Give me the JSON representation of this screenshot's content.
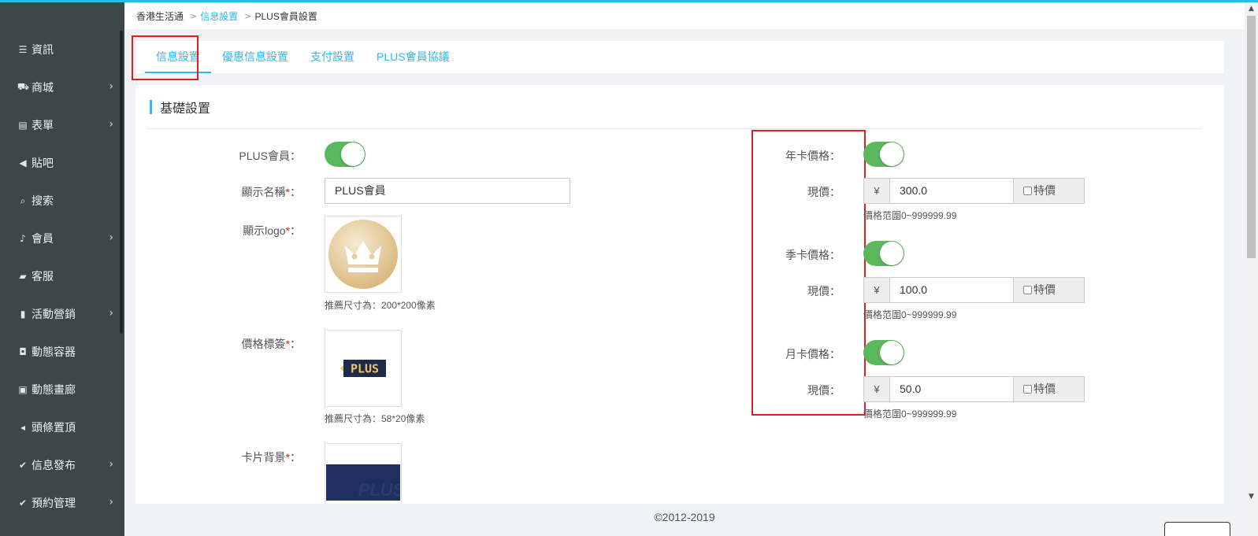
{
  "sidebar": {
    "items": [
      {
        "label": "資訊",
        "icon": "list-icon",
        "glyph": "☰",
        "chevron": false
      },
      {
        "label": "商城",
        "icon": "cart-icon",
        "glyph": "⛟",
        "chevron": true
      },
      {
        "label": "表單",
        "icon": "form-icon",
        "glyph": "▤",
        "chevron": true
      },
      {
        "label": "貼吧",
        "icon": "megaphone-icon",
        "glyph": "◀",
        "chevron": false
      },
      {
        "label": "搜索",
        "icon": "search-icon",
        "glyph": "⌕",
        "chevron": false
      },
      {
        "label": "會員",
        "icon": "bell-icon",
        "glyph": "♪",
        "chevron": true
      },
      {
        "label": "客服",
        "icon": "chat-icon",
        "glyph": "▰",
        "chevron": false
      },
      {
        "label": "活動營銷",
        "icon": "bookmark-icon",
        "glyph": "▮",
        "chevron": true
      },
      {
        "label": "動態容器",
        "icon": "drive-icon",
        "glyph": "◘",
        "chevron": false
      },
      {
        "label": "動態畫廊",
        "icon": "picture-icon",
        "glyph": "▣",
        "chevron": false
      },
      {
        "label": "頭條置頂",
        "icon": "volume-icon",
        "glyph": "◂",
        "chevron": false
      },
      {
        "label": "信息發布",
        "icon": "check-edit-icon",
        "glyph": "✔",
        "chevron": true
      },
      {
        "label": "預約管理",
        "icon": "check-edit-icon",
        "glyph": "✔",
        "chevron": true
      }
    ],
    "chevron_glyph": "›"
  },
  "breadcrumb": {
    "root": "香港生活通",
    "sep": ">",
    "section": "信息設置",
    "current": "PLUS會員設置"
  },
  "tabs": [
    {
      "label": "信息設置",
      "active": true
    },
    {
      "label": "優惠信息設置",
      "active": false
    },
    {
      "label": "支付設置",
      "active": false
    },
    {
      "label": "PLUS會員協議",
      "active": false
    }
  ],
  "section": {
    "title": "基礎設置"
  },
  "form": {
    "plus_member_label": "PLUS會員：",
    "display_name_label": "顯示名稱",
    "display_name_value": "PLUS會員",
    "logo_label": "顯示logo",
    "logo_hint": "推薦尺寸為：200*200像素",
    "price_tag_label": "價格標簽",
    "price_tag_hint": "推薦尺寸為：58*20像素",
    "price_tag_text": "PLUS",
    "card_bg_label": "卡片背景",
    "card_bg_text": "PLUS",
    "required_mark": "*",
    "colon": "："
  },
  "prices": {
    "currency": "¥",
    "special_label": "特價",
    "range_hint": "價格范圍0~999999.99",
    "current_label": "現價：",
    "items": [
      {
        "label": "年卡價格：",
        "enabled": true,
        "value": "300.0"
      },
      {
        "label": "季卡價格：",
        "enabled": true,
        "value": "100.0"
      },
      {
        "label": "月卡價格：",
        "enabled": true,
        "value": "50.0"
      }
    ]
  },
  "footer": {
    "copyright": "©2012-2019"
  },
  "colors": {
    "accent": "#2db7f5",
    "toggle_on": "#5cb85c",
    "highlight": "#e02020",
    "sidebar_bg": "#3e4747"
  }
}
